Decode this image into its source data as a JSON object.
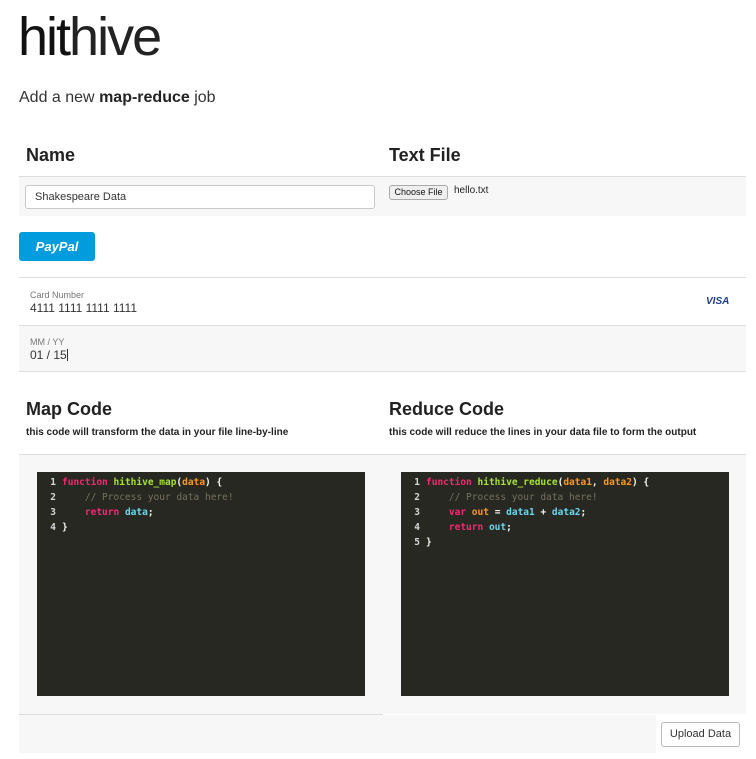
{
  "logo": {
    "bold": "hit",
    "light": "hive"
  },
  "subtitle": {
    "prefix": "Add a new ",
    "bold": "map-reduce",
    "suffix": " job"
  },
  "form": {
    "name_heading": "Name",
    "text_file_heading": "Text File",
    "name_value": "Shakespeare Data",
    "choose_file_label": "Choose File",
    "file_name": "hello.txt"
  },
  "payment": {
    "paypal_label": "PayPal",
    "card_number_label": "Card Number",
    "card_number_value": "4111 1111 1111 1111",
    "card_brand": "VISA",
    "expiry_label": "MM / YY",
    "expiry_value": "01 / 15"
  },
  "map": {
    "heading": "Map Code",
    "description": "this code will transform the data in your file line-by-line",
    "lines": [
      {
        "num": "1",
        "tokens": [
          {
            "c": "kw",
            "t": "function"
          },
          {
            "c": "pn",
            "t": " "
          },
          {
            "c": "fn",
            "t": "hithive_map"
          },
          {
            "c": "pn",
            "t": "("
          },
          {
            "c": "arg",
            "t": "data"
          },
          {
            "c": "pn",
            "t": ") {"
          }
        ]
      },
      {
        "num": "2",
        "tokens": [
          {
            "c": "pn",
            "t": "    "
          },
          {
            "c": "cm",
            "t": "// Process your data here!"
          }
        ]
      },
      {
        "num": "3",
        "tokens": [
          {
            "c": "pn",
            "t": "    "
          },
          {
            "c": "kw",
            "t": "return"
          },
          {
            "c": "pn",
            "t": " "
          },
          {
            "c": "id",
            "t": "data"
          },
          {
            "c": "pn",
            "t": ";"
          }
        ]
      },
      {
        "num": "4",
        "tokens": [
          {
            "c": "pn",
            "t": "}"
          }
        ]
      }
    ]
  },
  "reduce": {
    "heading": "Reduce Code",
    "description": "this code will reduce the lines in your data file to form the output",
    "lines": [
      {
        "num": "1",
        "tokens": [
          {
            "c": "kw",
            "t": "function"
          },
          {
            "c": "pn",
            "t": " "
          },
          {
            "c": "fn",
            "t": "hithive_reduce"
          },
          {
            "c": "pn",
            "t": "("
          },
          {
            "c": "arg",
            "t": "data1"
          },
          {
            "c": "pn",
            "t": ", "
          },
          {
            "c": "arg",
            "t": "data2"
          },
          {
            "c": "pn",
            "t": ") {"
          }
        ]
      },
      {
        "num": "2",
        "tokens": [
          {
            "c": "pn",
            "t": "    "
          },
          {
            "c": "cm",
            "t": "// Process your data here!"
          }
        ]
      },
      {
        "num": "3",
        "tokens": [
          {
            "c": "pn",
            "t": "    "
          },
          {
            "c": "kw",
            "t": "var"
          },
          {
            "c": "pn",
            "t": " "
          },
          {
            "c": "arg",
            "t": "out"
          },
          {
            "c": "pn",
            "t": " = "
          },
          {
            "c": "id",
            "t": "data1"
          },
          {
            "c": "pn",
            "t": " + "
          },
          {
            "c": "id",
            "t": "data2"
          },
          {
            "c": "pn",
            "t": ";"
          }
        ]
      },
      {
        "num": "4",
        "tokens": [
          {
            "c": "pn",
            "t": "    "
          },
          {
            "c": "kw",
            "t": "return"
          },
          {
            "c": "pn",
            "t": " "
          },
          {
            "c": "id",
            "t": "out"
          },
          {
            "c": "pn",
            "t": ";"
          }
        ]
      },
      {
        "num": "5",
        "tokens": [
          {
            "c": "pn",
            "t": "}"
          }
        ]
      }
    ]
  },
  "actions": {
    "upload_label": "Upload Data"
  },
  "colors": {
    "paypal_blue": "#009cde",
    "editor_bg": "#272822",
    "keyword": "#f92672",
    "function": "#a6e22e",
    "argument": "#fd971f",
    "identifier": "#66d9ef",
    "comment": "#75715e"
  }
}
